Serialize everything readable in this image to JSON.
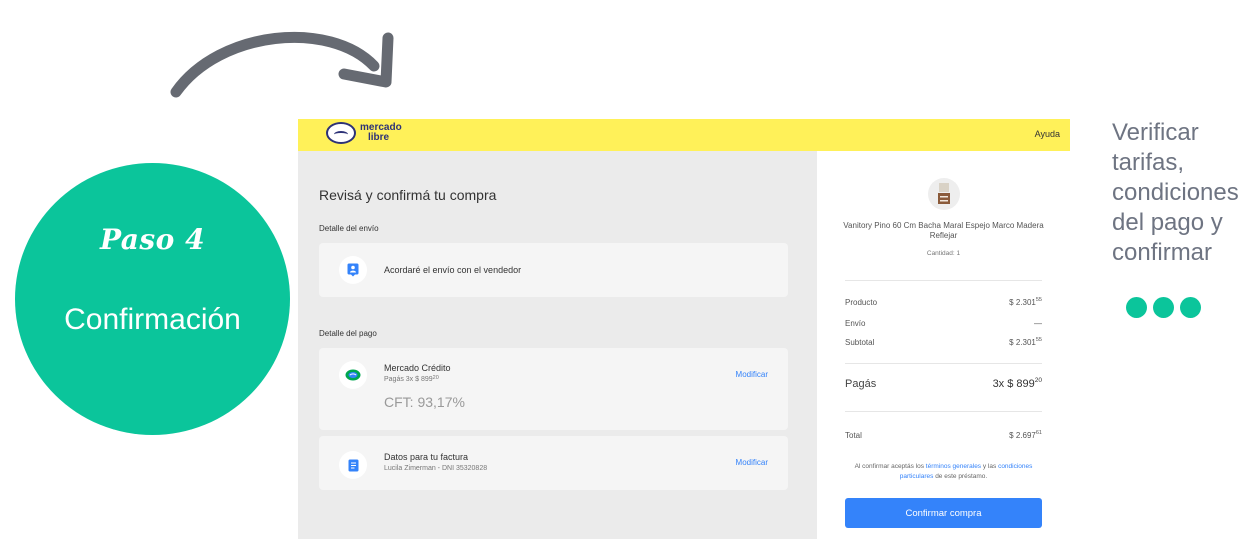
{
  "step": {
    "title": "Paso 4",
    "name": "Confirmación"
  },
  "note": {
    "line1": "Verificar",
    "line2": "tarifas,",
    "line3": "condiciones",
    "line4": "del pago y",
    "line5": "confirmar"
  },
  "colors": {
    "accent": "#0bc59b",
    "header": "#fff159",
    "link": "#3483fa",
    "note_text": "#6e7482"
  },
  "screenshot": {
    "header": {
      "logo_line1": "mercado",
      "logo_line2": "libre",
      "help": "Ayuda"
    },
    "title": "Revisá y confirmá tu compra",
    "shipping": {
      "section_label": "Detalle del envío",
      "icon": "location-pin-icon",
      "text": "Acordaré el envío con el vendedor"
    },
    "payment": {
      "section_label": "Detalle del pago",
      "method": {
        "icon": "mercado-credito-icon",
        "name": "Mercado Crédito",
        "installments": "Pagás 3x $ 899",
        "installments_cents": "20",
        "cft": "CFT: 93,17%",
        "modify": "Modificar"
      },
      "invoice": {
        "icon": "document-icon",
        "title": "Datos para tu factura",
        "detail": "Lucila Zimerman - DNI 35320828",
        "modify": "Modificar"
      }
    },
    "summary": {
      "product_name": "Vanitory Pino 60 Cm Bacha Maral Espejo Marco Madera Reflejar",
      "quantity": "Cantidad: 1",
      "product_label": "Producto",
      "product_value": "$ 2.301",
      "product_cents": "55",
      "shipping_label": "Envío",
      "shipping_value": "—",
      "subtotal_label": "Subtotal",
      "subtotal_value": "$ 2.301",
      "subtotal_cents": "55",
      "pay_label": "Pagás",
      "pay_value": "3x $ 899",
      "pay_cents": "20",
      "total_label": "Total",
      "total_value": "$ 2.697",
      "total_cents": "61",
      "legal_1": "Al confirmar aceptás los",
      "legal_link1": "términos generales",
      "legal_2": "y las",
      "legal_link2": "condiciones particulares",
      "legal_3": "de este préstamo.",
      "confirm_button": "Confirmar compra"
    }
  }
}
